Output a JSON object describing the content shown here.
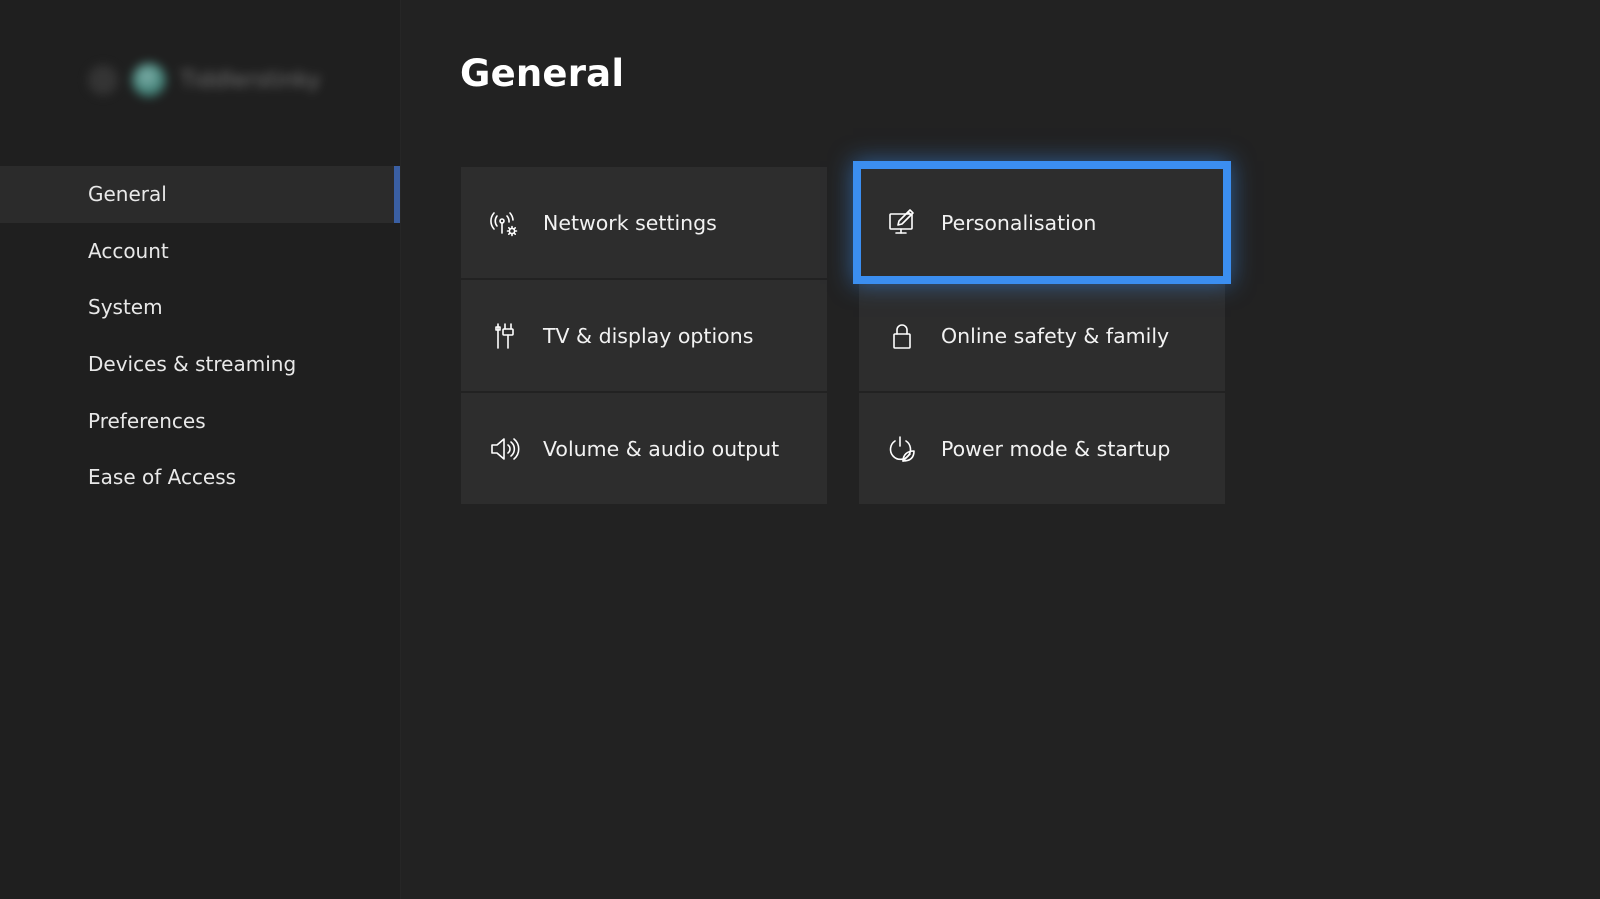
{
  "sidebar": {
    "gamertag": "Tiddlerstinky",
    "items": [
      {
        "label": "General",
        "active": true
      },
      {
        "label": "Account",
        "active": false
      },
      {
        "label": "System",
        "active": false
      },
      {
        "label": "Devices & streaming",
        "active": false
      },
      {
        "label": "Preferences",
        "active": false
      },
      {
        "label": "Ease of Access",
        "active": false
      }
    ]
  },
  "main": {
    "title": "General",
    "tiles": [
      {
        "label": "Network settings",
        "icon": "network-settings-icon",
        "focused": false
      },
      {
        "label": "Personalisation",
        "icon": "personalisation-icon",
        "focused": true
      },
      {
        "label": "TV & display options",
        "icon": "tv-display-icon",
        "focused": false
      },
      {
        "label": "Online safety & family",
        "icon": "lock-icon",
        "focused": false
      },
      {
        "label": "Volume & audio output",
        "icon": "speaker-icon",
        "focused": false
      },
      {
        "label": "Power mode & startup",
        "icon": "power-leaf-icon",
        "focused": false
      }
    ]
  },
  "colors": {
    "background": "#222222",
    "sidebar_background": "#1f1f1f",
    "tile_background": "#2d2d2d",
    "focus_ring": "#3b8ef0",
    "active_nav_indicator": "#3a5fa3"
  }
}
